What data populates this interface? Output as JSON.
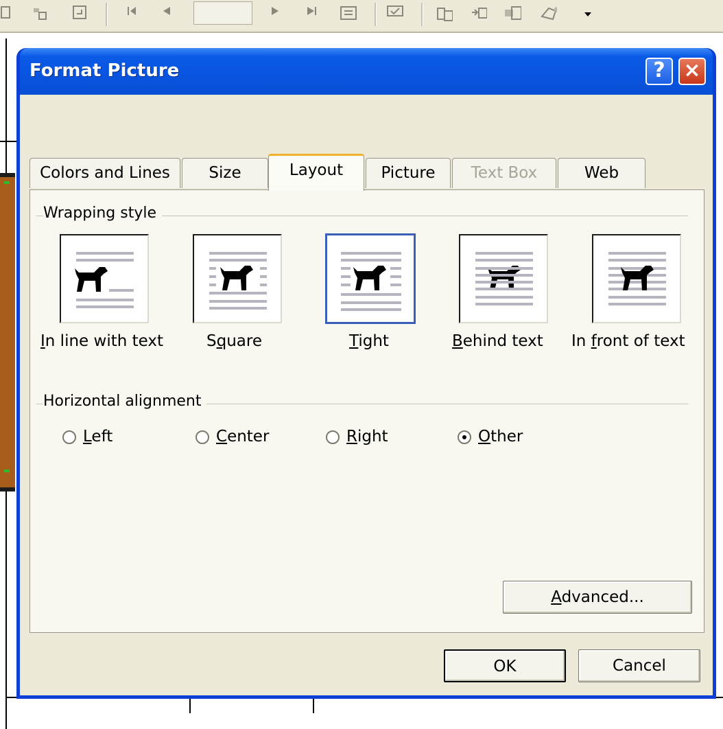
{
  "dialog": {
    "title": "Format Picture",
    "help_label": "?",
    "close_label": "×"
  },
  "tabs": [
    {
      "label": "Colors and Lines",
      "state": "normal"
    },
    {
      "label": "Size",
      "state": "normal"
    },
    {
      "label": "Layout",
      "state": "active"
    },
    {
      "label": "Picture",
      "state": "normal"
    },
    {
      "label": "Text Box",
      "state": "disabled"
    },
    {
      "label": "Web",
      "state": "normal"
    }
  ],
  "wrapping": {
    "group_label": "Wrapping style",
    "selected": "Tight",
    "options": [
      {
        "pre": "",
        "key": "I",
        "post": "n line with text"
      },
      {
        "pre": "S",
        "key": "q",
        "post": "uare"
      },
      {
        "pre": "",
        "key": "T",
        "post": "ight"
      },
      {
        "pre": "",
        "key": "B",
        "post": "ehind text"
      },
      {
        "pre": "In ",
        "key": "f",
        "post": "ront of text"
      }
    ]
  },
  "alignment": {
    "group_label": "Horizontal alignment",
    "selected": "Other",
    "options": [
      {
        "pre": "",
        "key": "L",
        "post": "eft"
      },
      {
        "pre": "",
        "key": "C",
        "post": "enter"
      },
      {
        "pre": "",
        "key": "R",
        "post": "ight"
      },
      {
        "pre": "",
        "key": "O",
        "post": "ther"
      }
    ]
  },
  "buttons": {
    "advanced": {
      "pre": "",
      "key": "A",
      "post": "dvanced..."
    },
    "ok": "OK",
    "cancel": "Cancel"
  },
  "colors": {
    "title_blue": "#0a54e0",
    "dialog_face": "#ece9d8",
    "tab_accent": "#f0b02b",
    "close_red": "#c8361b"
  }
}
